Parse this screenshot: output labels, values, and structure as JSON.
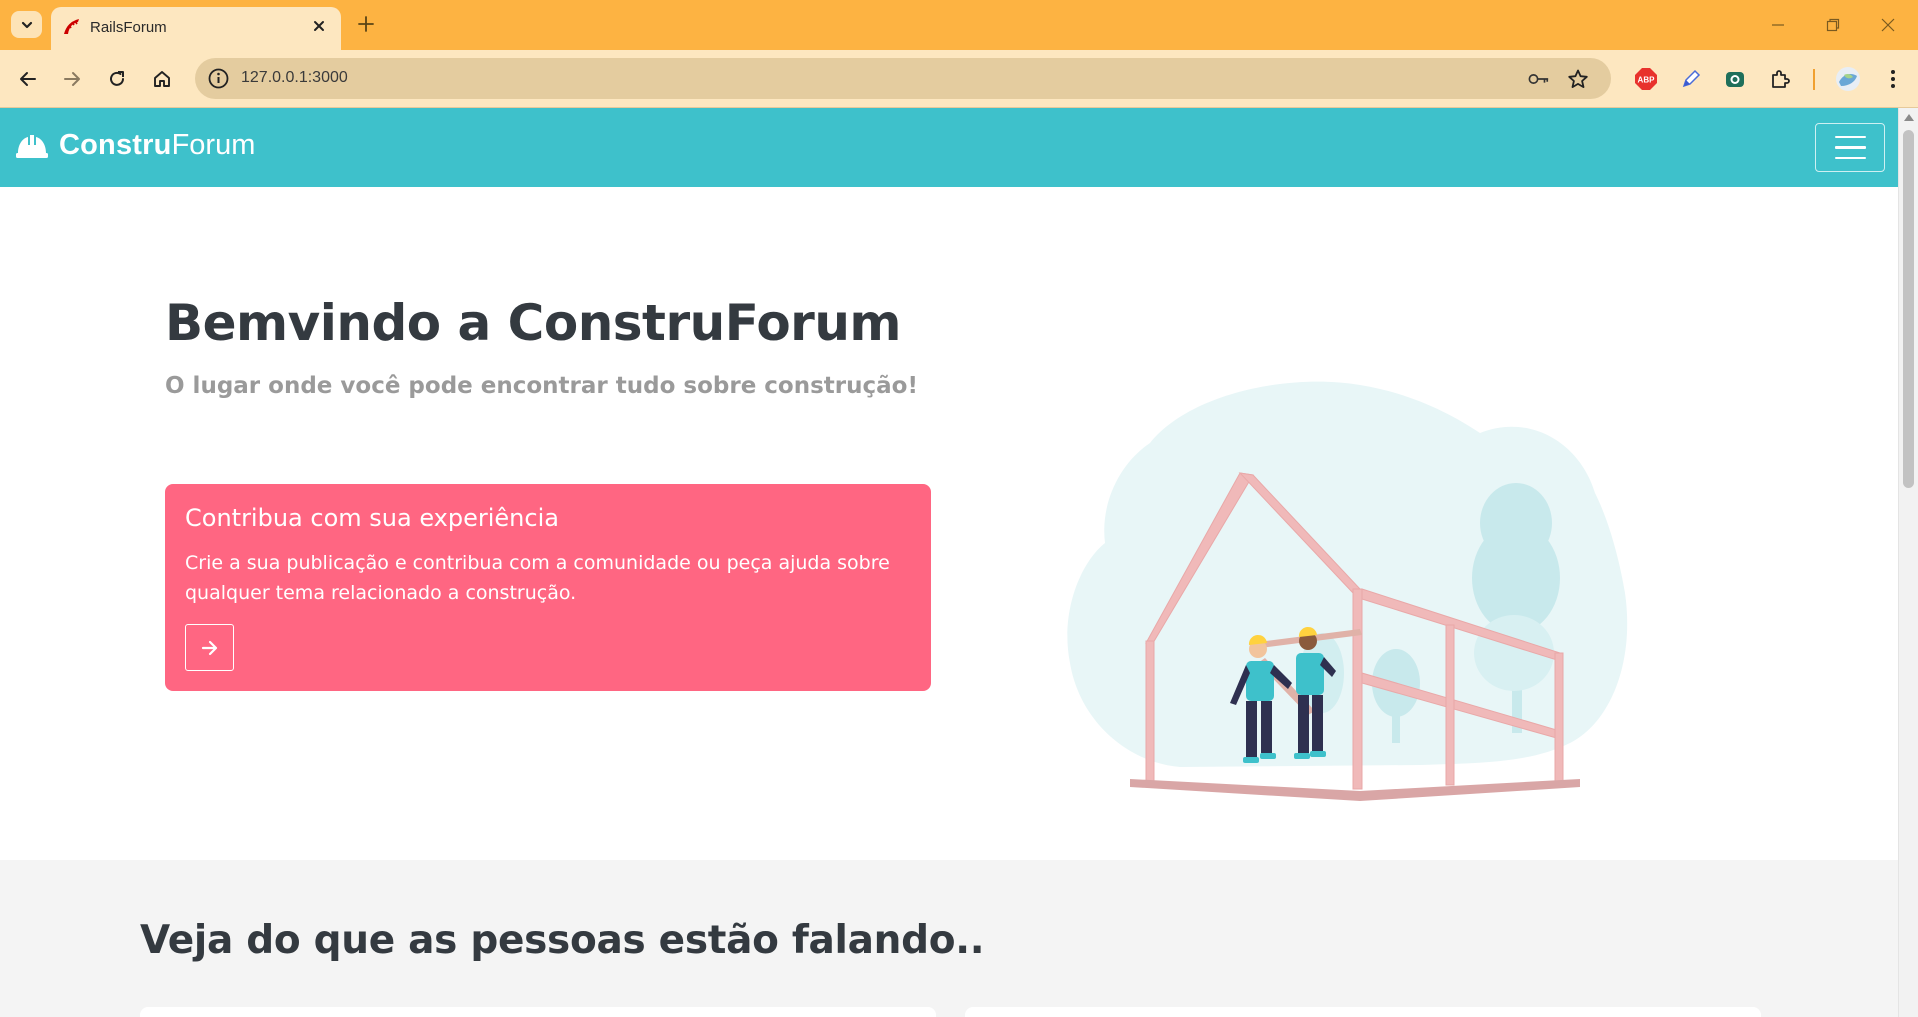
{
  "browser": {
    "tab_title": "RailsForum",
    "url": "127.0.0.1:3000",
    "icons": [
      "tab-search-icon",
      "rails-favicon",
      "close-icon",
      "new-tab-icon",
      "minimize-icon",
      "restore-icon",
      "window-close-icon",
      "back-icon",
      "forward-icon",
      "reload-icon",
      "home-icon",
      "site-info-icon",
      "password-key-icon",
      "bookmark-star-icon",
      "adblock-extension-icon",
      "pen-extension-icon",
      "camera-extension-icon",
      "puzzle-extensions-icon",
      "profile-avatar-icon",
      "kebab-menu-icon"
    ],
    "adblock_label": "ABP"
  },
  "navbar": {
    "brand_bold": "Constru",
    "brand_light": "Forum",
    "brand_icon": "hard-hat-icon",
    "menu_icon": "hamburger-menu-icon"
  },
  "hero": {
    "title": "Bemvindo a ConstruForum",
    "subtitle": "O lugar onde você pode encontrar tudo sobre construção!"
  },
  "cta_card": {
    "title": "Contribua com sua experiência",
    "text": "Crie a sua publicação e contribua com a comunidade ou peça ajuda sobre qualquer tema relacionado a construção.",
    "button_icon": "arrow-right-icon"
  },
  "section": {
    "title": "Veja do que as pessoas estão falando.."
  },
  "colors": {
    "tabstrip": "#fdb342",
    "toolbar": "#fde7c0",
    "navbar": "#3ec1cb",
    "cta": "#ff6682",
    "heading": "#343a40",
    "subtitle": "#9a9a9a"
  }
}
